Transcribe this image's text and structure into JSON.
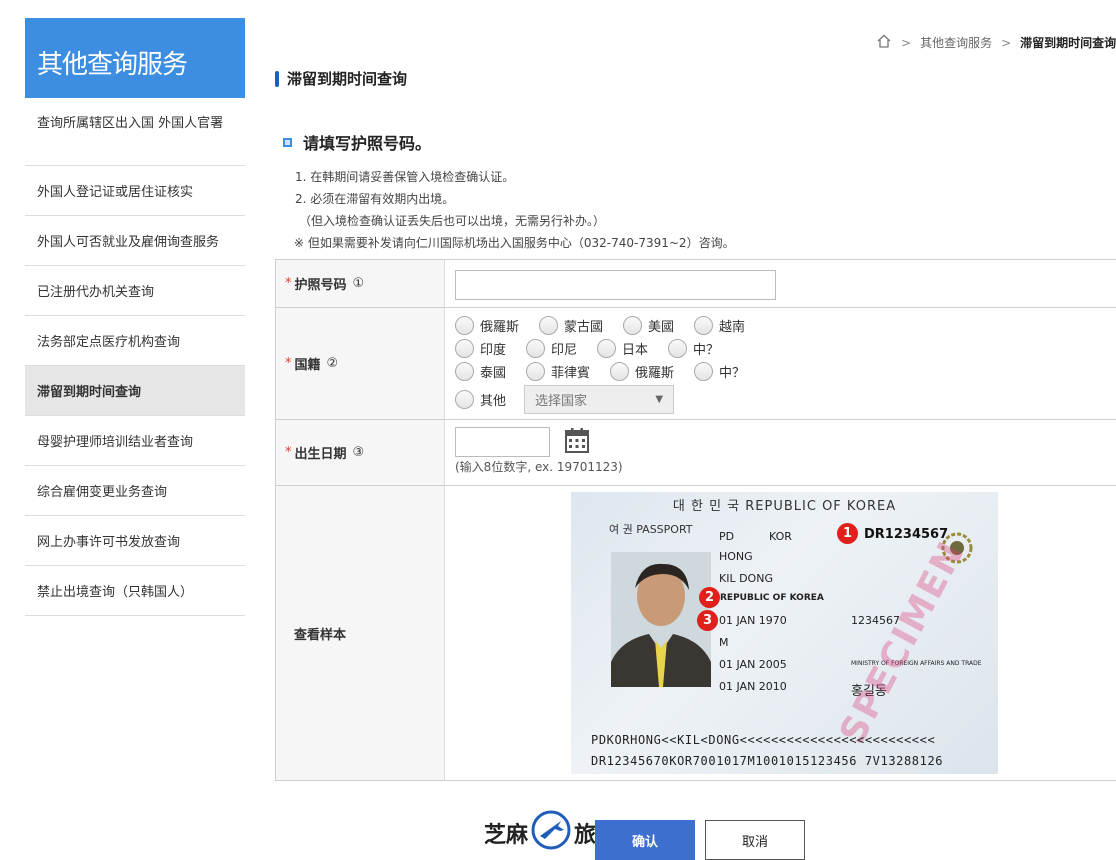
{
  "sidebar": {
    "title": "其他查询服务",
    "items": [
      {
        "label": "查询所属辖区出入国 外国人官署"
      },
      {
        "label": "外国人登记证或居住证核实"
      },
      {
        "label": "外国人可否就业及雇佣询查服务"
      },
      {
        "label": "已注册代办机关查询"
      },
      {
        "label": "法务部定点医疗机构查询"
      },
      {
        "label": "滞留到期时间查询"
      },
      {
        "label": "母婴护理师培训结业者查询"
      },
      {
        "label": "综合雇佣变更业务查询"
      },
      {
        "label": "网上办事许可书发放查询"
      },
      {
        "label": "禁止出境查询（只韩国人）"
      }
    ]
  },
  "breadcrumb": {
    "sep": ">",
    "parent": "其他查询服务",
    "current": "滞留到期时间查询"
  },
  "page": {
    "title": "滞留到期时间查询",
    "section_heading": "请填写护照号码。",
    "notes": [
      "1. 在韩期间请妥善保管入境检查确认证。",
      "2. 必须在滞留有效期内出境。",
      "（但入境检查确认证丢失后也可以出境，无需另行补办。）",
      "※ 但如果需要补发请向仁川国际机场出入国服务中心（032-740-7391~2）咨询。"
    ]
  },
  "form": {
    "required_mark": "*",
    "passport_label": "护照号码",
    "passport_num": "①",
    "passport_value": "",
    "nationality_label": "国籍",
    "nationality_num": "②",
    "countries_row1": [
      "俄羅斯",
      "蒙古國",
      "美國",
      "越南"
    ],
    "countries_row2": [
      "印度",
      "印尼",
      "日本",
      "中？"
    ],
    "countries_row3": [
      "泰國",
      "菲律賓",
      "俄羅斯",
      "中？"
    ],
    "other_label": "其他",
    "select_placeholder": "选择国家",
    "birth_label": "出生日期",
    "birth_num": "③",
    "birth_hint": "(输入8位数字, ex. 19701123)",
    "sample_label": "查看样本"
  },
  "passport_sample": {
    "header": "대 한 민 국  REPUBLIC OF KOREA",
    "type_label": "여 권  PASSPORT",
    "type": "PD",
    "country": "KOR",
    "number": "DR1234567",
    "surname": "HONG",
    "given": "KIL DONG",
    "nationality": "REPUBLIC OF KOREA",
    "dob": "01 JAN 1970",
    "personal_no": "1234567",
    "sex": "M",
    "issue": "01 JAN 2005",
    "expiry": "01 JAN 2010",
    "authority": "MINISTRY OF FOREIGN AFFAIRS AND TRADE",
    "korean_name": "홍길동",
    "specimen": "SPECIMEN",
    "mrz1": "PDKORHONG<<KIL<DONG<<<<<<<<<<<<<<<<<<<<<<<<<",
    "mrz2": "DR12345670KOR7001017M1001015123456 7V13288126",
    "badges": [
      "1",
      "2",
      "3"
    ]
  },
  "buttons": {
    "confirm": "确认",
    "cancel": "取消"
  },
  "watermark": {
    "left": "芝麻",
    "right": "旅行"
  },
  "colors": {
    "accent": "#3d8ee0",
    "confirm_bg": "#3d6fd1",
    "required": "#e03c31",
    "badge": "#e0201b"
  }
}
